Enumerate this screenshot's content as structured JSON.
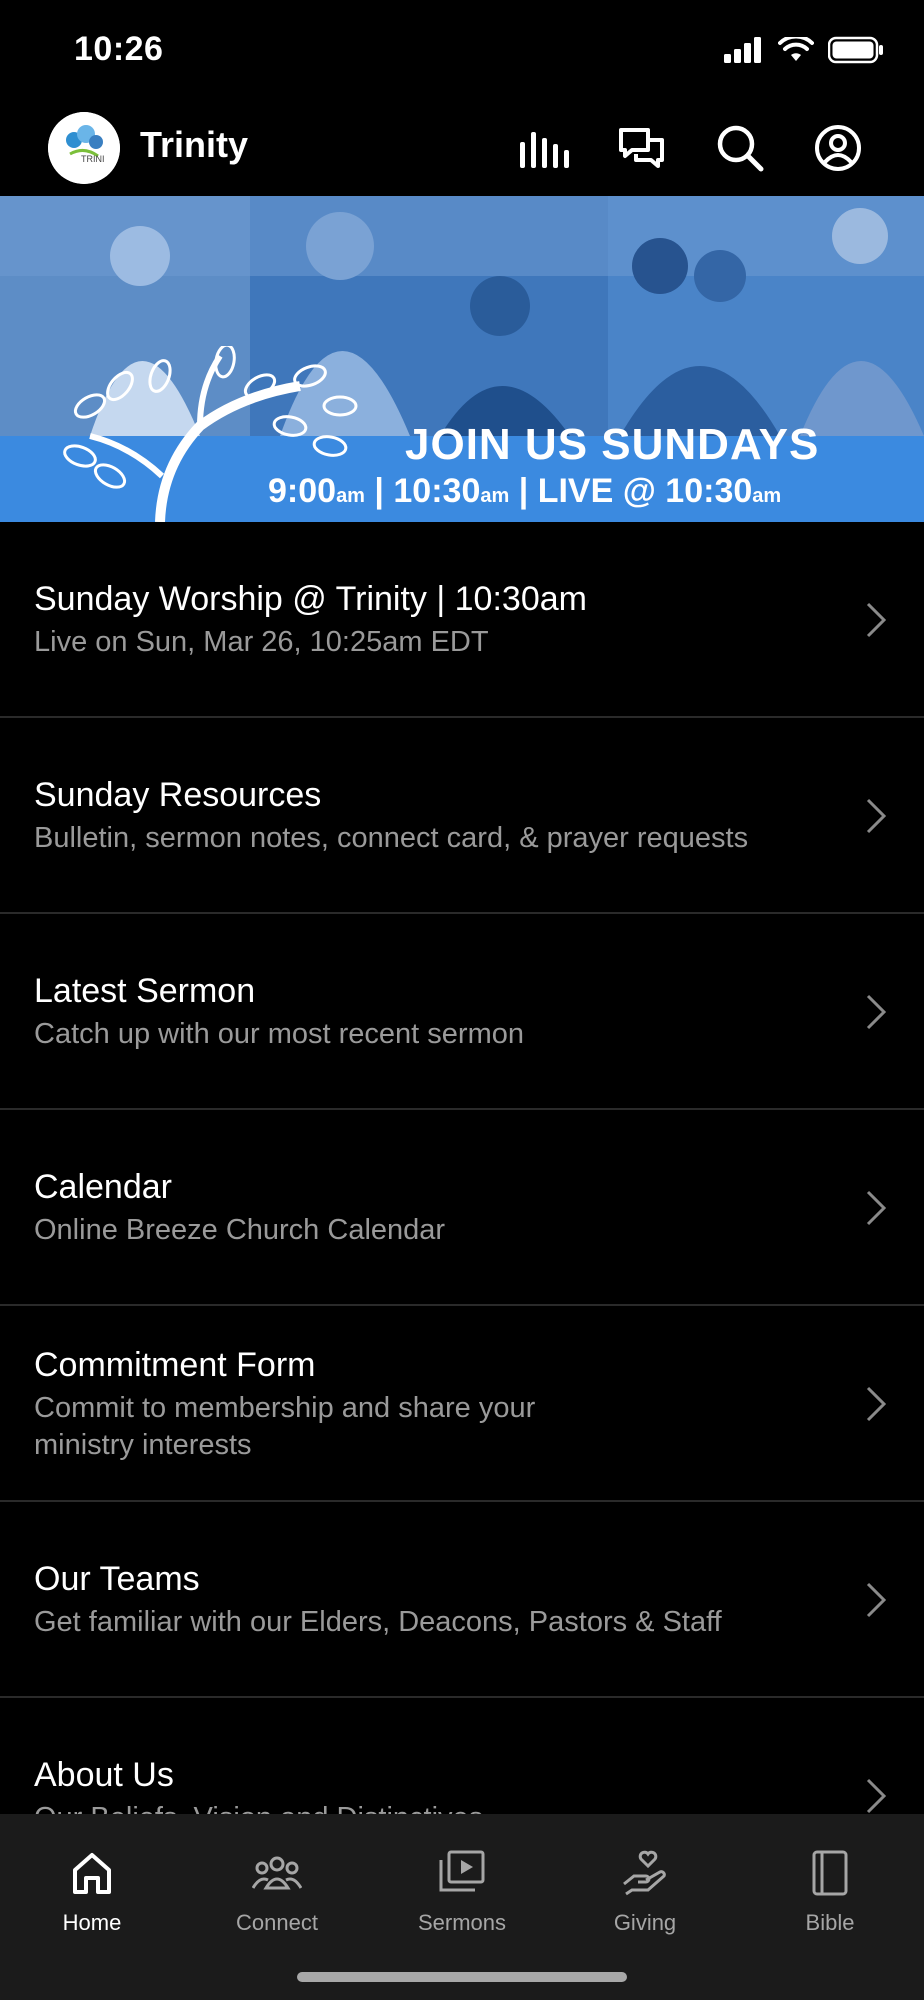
{
  "status_bar": {
    "time": "10:26"
  },
  "header": {
    "app_title": "Trinity",
    "logo_text": "TRINI",
    "icons": [
      "audio-bars-icon",
      "chat-icon",
      "search-icon",
      "profile-icon"
    ]
  },
  "banner": {
    "heading": "JOIN US SUNDAYS",
    "times": [
      {
        "time": "9:00",
        "suffix": "am"
      },
      {
        "time": "10:30",
        "suffix": "am"
      },
      {
        "time": "LIVE @ 10:30",
        "suffix": "am"
      }
    ]
  },
  "list": [
    {
      "title": "Sunday Worship @ Trinity | 10:30am",
      "subtitle": "Live on Sun, Mar 26, 10:25am EDT"
    },
    {
      "title": "Sunday Resources",
      "subtitle": "Bulletin, sermon notes, connect card, & prayer requests"
    },
    {
      "title": "Latest Sermon",
      "subtitle": "Catch up with our most recent sermon"
    },
    {
      "title": "Calendar",
      "subtitle": "Online Breeze Church Calendar"
    },
    {
      "title": "Commitment Form",
      "subtitle": "Commit to membership and share your ministry interests"
    },
    {
      "title": "Our Teams",
      "subtitle": "Get familiar with our Elders, Deacons, Pastors & Staff"
    },
    {
      "title": "About Us",
      "subtitle": "Our Beliefs, Vision and Distinctives"
    }
  ],
  "tabs": [
    {
      "label": "Home",
      "icon": "home-icon",
      "active": true
    },
    {
      "label": "Connect",
      "icon": "people-icon",
      "active": false
    },
    {
      "label": "Sermons",
      "icon": "video-library-icon",
      "active": false
    },
    {
      "label": "Giving",
      "icon": "giving-hand-icon",
      "active": false
    },
    {
      "label": "Bible",
      "icon": "book-icon",
      "active": false
    }
  ],
  "colors": {
    "background": "#000000",
    "banner_blue": "#3b8ae0",
    "tabbar": "#1b1b1b",
    "subtitle_gray": "#9a9a9a"
  }
}
